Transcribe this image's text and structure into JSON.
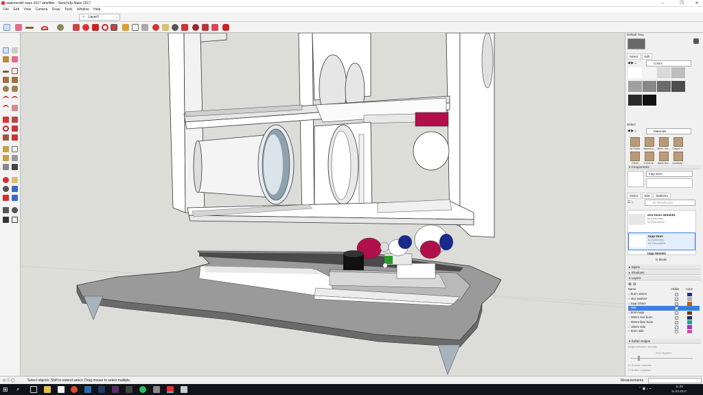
{
  "window": {
    "title": "statemerdill mars 2017 delefilter - SketchUp Make 2017",
    "controls": {
      "minimize": "–",
      "maximize": "❐",
      "close": "✕"
    }
  },
  "menu": [
    "File",
    "Edit",
    "View",
    "Camera",
    "Draw",
    "Tools",
    "Window",
    "Help"
  ],
  "layer_toolbar": {
    "check": "✓",
    "current_layer": "Layer0"
  },
  "toolbar_icons": [
    "select-icon",
    "eraser-icon",
    "pencil-icon",
    "arc-icon",
    "shape-icon",
    "pushpull-icon",
    "move-icon",
    "rotate-icon",
    "offset-icon",
    "scale-icon",
    "tape-icon",
    "dimension-icon",
    "text-icon",
    "axes-icon",
    "orbit-icon",
    "pan-icon",
    "zoom-icon",
    "zoom-extents-icon",
    "warehouse-icon",
    "extension-icon",
    "share-icon",
    "ruby-icon"
  ],
  "tray": {
    "header": "Default Tray",
    "styles_tabs": [
      "Select",
      "Edit"
    ],
    "colors_dropdown": "Colors",
    "colors_swatches": [
      "#ffffff",
      "#f4f4f4",
      "#d9d9d9",
      "#bdbdbd",
      "#a0a0a0",
      "#878787",
      "#6a6a6a",
      "#4d4d4d",
      "#2b2b2b",
      "#111111"
    ],
    "materials_section": "Select",
    "materials_dropdown": "Materials",
    "materials": [
      "3d Printer",
      "Asphalt a...",
      "Brick, Cla...",
      "Carpet, F...",
      "Colors",
      "Colors-N...",
      "Glass and...",
      "Landscap..."
    ],
    "components_header": "Components",
    "component_name": "topp 5mm",
    "component_tabs": [
      "Select",
      "Edit",
      "Statistics"
    ],
    "warehouse_search": "3D Warehouse",
    "component_list": [
      {
        "name": "stor bunn 18mm01",
        "by": "by (Unknown)",
        "desc": "No Description"
      },
      {
        "name": "topp 5mm",
        "by": "by (Unknown)",
        "desc": "No Description"
      },
      {
        "name": "topp 5mm01",
        "by": "",
        "desc": ""
      }
    ],
    "in_model": "In Model",
    "collapsed_panels": [
      "Styles",
      "Shadows"
    ],
    "layers_header": "Layers",
    "layers_columns": [
      "Name",
      "Visible",
      "Color"
    ],
    "layers": [
      {
        "name": "bunn 18mm",
        "visible": true,
        "color": "#2a2a8a"
      },
      {
        "name": "stor avstiver",
        "visible": true,
        "color": "#b0b0b0"
      },
      {
        "name": "topp 18mm",
        "visible": true,
        "color": "#c86010"
      },
      {
        "name": "side",
        "visible": true,
        "color": "#3a80c8"
      },
      {
        "name": "5mm topp",
        "visible": true,
        "color": "#6b3a14"
      },
      {
        "name": "36mm stor bunn",
        "visible": true,
        "color": "#1a2e6a"
      },
      {
        "name": "36mm liten bunn",
        "visible": true,
        "color": "#2aa090"
      },
      {
        "name": "18mm side",
        "visible": false,
        "color": "#b030c0"
      },
      {
        "name": "5mm side",
        "visible": false,
        "color": "#d050a0"
      }
    ],
    "soften_header": "Soften Edges",
    "soften_label": "Angle between normals",
    "soften_value": "20,0 degrees",
    "smooth_normals": "Smooth normals",
    "soften_coplanar": "Soften coplanar"
  },
  "status": {
    "hint": "Select objects. Shift to extend select. Drag mouse to select multiple.",
    "measurements_label": "Measurements"
  },
  "taskbar": {
    "time": "11.00",
    "date": "11.03.2017"
  }
}
